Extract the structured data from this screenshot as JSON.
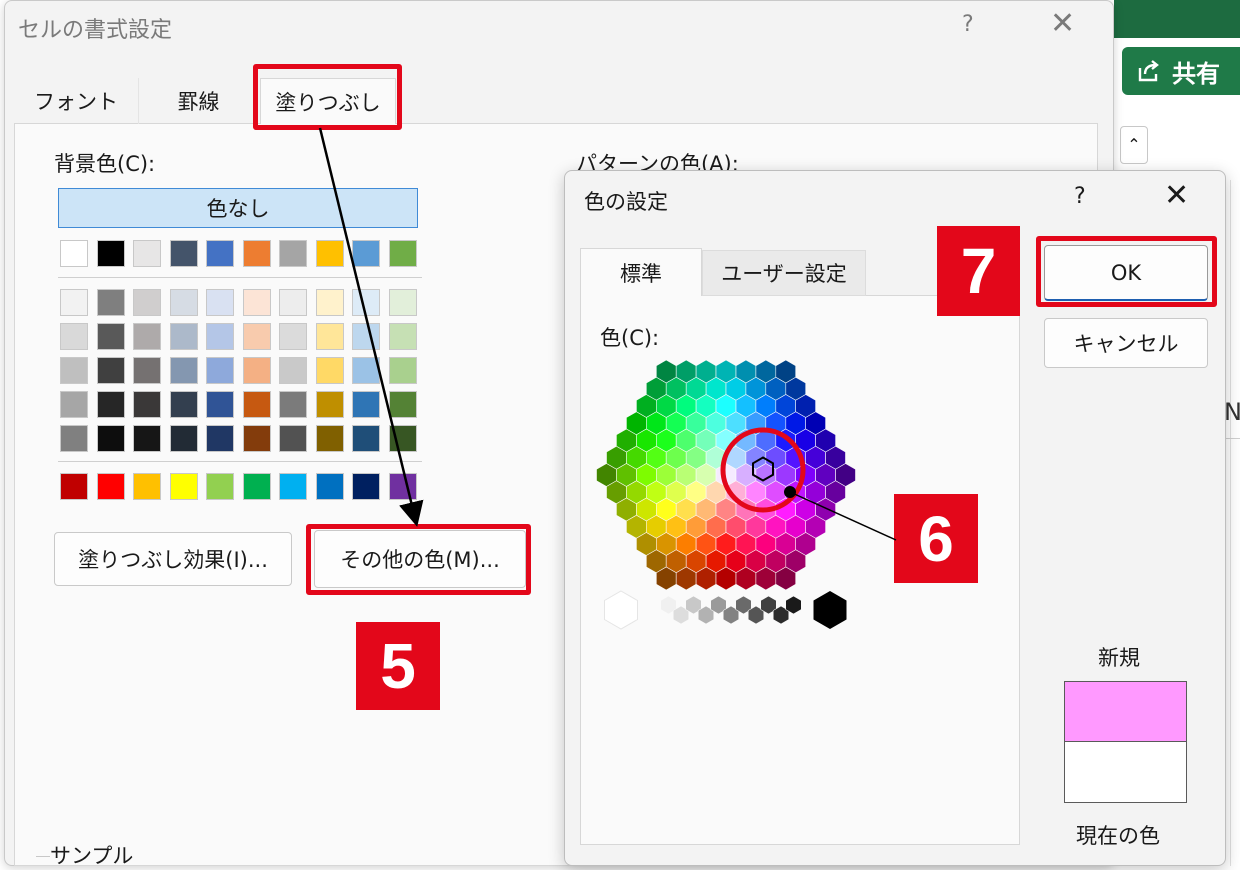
{
  "excel": {
    "share_label": "共有",
    "column_letter": "N"
  },
  "format_dialog": {
    "title": "セルの書式設定",
    "help": "?",
    "close": "✕",
    "tabs": [
      {
        "label": "フォント"
      },
      {
        "label": "罫線"
      },
      {
        "label": "塗りつぶし"
      }
    ],
    "background_color_label": "背景色(C):",
    "pattern_color_label": "パターンの色(A):",
    "no_color_label": "色なし",
    "fill_effects_label": "塗りつぶし効果(I)...",
    "more_colors_label": "その他の色(M)...",
    "sample_label": "サンプル",
    "palette": {
      "theme_row": [
        "#ffffff",
        "#000000",
        "#e7e6e6",
        "#44546a",
        "#4472c4",
        "#ed7d31",
        "#a5a5a5",
        "#ffc000",
        "#5b9bd5",
        "#70ad47"
      ],
      "tint_rows": [
        [
          "#f2f2f2",
          "#7f7f7f",
          "#d0cece",
          "#d6dce4",
          "#d9e1f2",
          "#fce4d6",
          "#ededed",
          "#fff2cc",
          "#ddebf7",
          "#e2efda"
        ],
        [
          "#d9d9d9",
          "#595959",
          "#aeaaaa",
          "#acb9ca",
          "#b4c6e7",
          "#f8cbad",
          "#dbdbdb",
          "#ffe699",
          "#bdd7ee",
          "#c6e0b4"
        ],
        [
          "#bfbfbf",
          "#404040",
          "#757171",
          "#8497b0",
          "#8ea9db",
          "#f4b084",
          "#c9c9c9",
          "#ffd966",
          "#9bc2e6",
          "#a9d08e"
        ],
        [
          "#a6a6a6",
          "#262626",
          "#3a3838",
          "#333f4f",
          "#305496",
          "#c65911",
          "#7b7b7b",
          "#bf8f00",
          "#2f75b5",
          "#548235"
        ],
        [
          "#808080",
          "#0d0d0d",
          "#161616",
          "#222b35",
          "#203764",
          "#833c0c",
          "#525252",
          "#806000",
          "#1f4e78",
          "#375623"
        ]
      ],
      "standard_row": [
        "#c00000",
        "#ff0000",
        "#ffc000",
        "#ffff00",
        "#92d050",
        "#00b050",
        "#00b0f0",
        "#0070c0",
        "#002060",
        "#7030a0"
      ]
    }
  },
  "colors_dialog": {
    "title": "色の設定",
    "help": "?",
    "close": "✕",
    "tabs": [
      {
        "label": "標準"
      },
      {
        "label": "ユーザー設定"
      }
    ],
    "color_label": "色(C):",
    "ok_label": "OK",
    "cancel_label": "キャンセル",
    "new_label": "新規",
    "current_label": "現在の色",
    "new_color": "#ff99ff",
    "current_color": "#ffffff"
  },
  "steps": {
    "step5": "5",
    "step6": "6",
    "step7": "7"
  },
  "colors": {
    "highlight": "#e3071a",
    "excel_green": "#1f7a48",
    "selection_blue": "#cce4f7"
  }
}
